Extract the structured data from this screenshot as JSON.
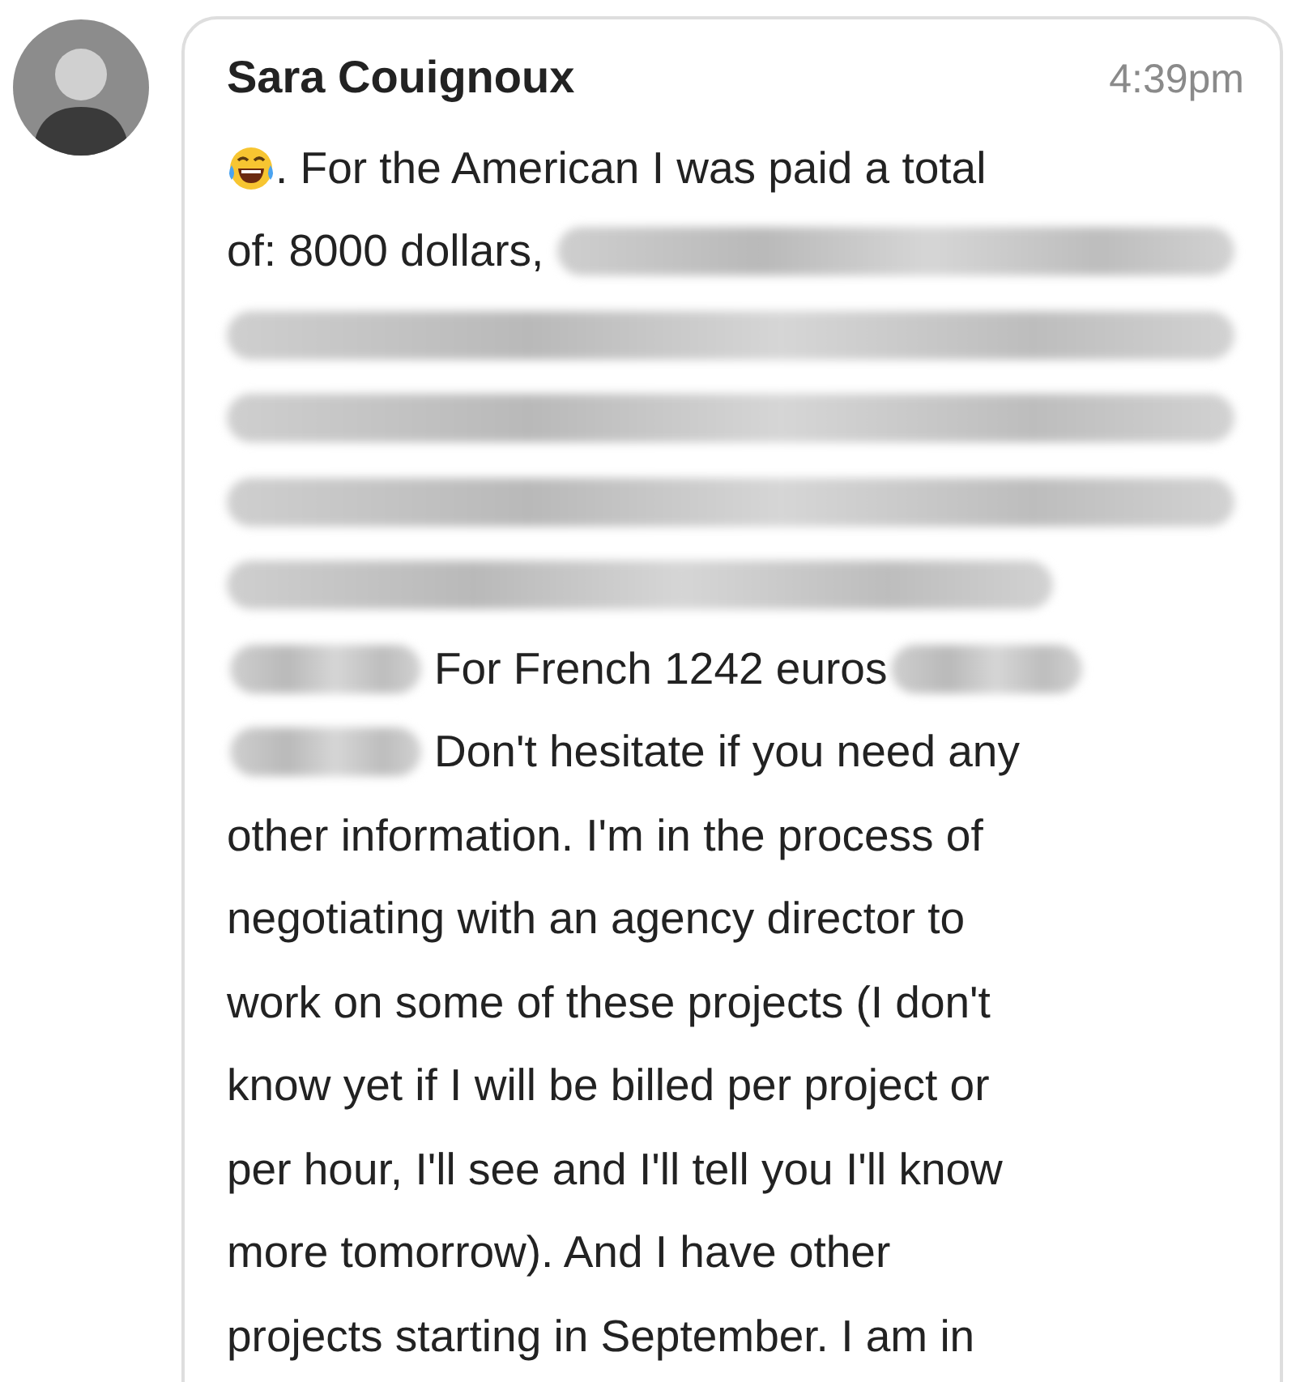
{
  "message": {
    "sender": "Sara Couignoux",
    "time": "4:39pm",
    "lines": [
      [
        {
          "kind": "emoji"
        },
        {
          "kind": "text",
          "text": ". For the American I was paid a total"
        }
      ],
      [
        {
          "kind": "text",
          "text": "of: 8000 dollars,"
        },
        {
          "kind": "blurfill"
        }
      ],
      [
        {
          "kind": "blurfill"
        }
      ],
      [
        {
          "kind": "blurfill"
        }
      ],
      [
        {
          "kind": "blurfill"
        }
      ],
      [
        {
          "kind": "blurlong"
        }
      ],
      [
        {
          "kind": "blurshort"
        },
        {
          "kind": "text",
          "text": "For French 1242 euros"
        },
        {
          "kind": "blurshort"
        }
      ],
      [
        {
          "kind": "blurshort"
        },
        {
          "kind": "text",
          "text": "Don't hesitate if you need any"
        }
      ],
      [
        {
          "kind": "text",
          "text": "other information. I'm in the process of"
        }
      ],
      [
        {
          "kind": "text",
          "text": "negotiating with an agency director to"
        }
      ],
      [
        {
          "kind": "text",
          "text": "work on some of these projects (I don't"
        }
      ],
      [
        {
          "kind": "text",
          "text": "know yet if I will be billed per project or"
        }
      ],
      [
        {
          "kind": "text",
          "text": "per hour, I'll see and I'll tell you I'll know"
        }
      ],
      [
        {
          "kind": "text",
          "text": "more tomorrow). And I have other"
        }
      ],
      [
        {
          "kind": "text",
          "text": "projects starting in September. I am in"
        }
      ]
    ]
  }
}
